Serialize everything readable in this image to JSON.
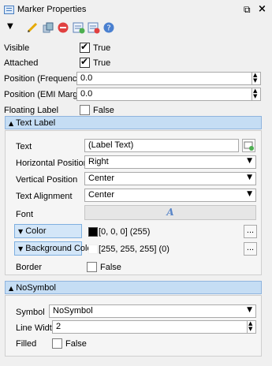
{
  "window": {
    "title": "Marker Properties",
    "float_icon": "float-icon",
    "close_icon": "close-icon"
  },
  "toolbar": {
    "icons": [
      "dropdown-arrow-icon",
      "pencil-icon",
      "copy-icon",
      "delete-icon",
      "export-icon",
      "import-icon",
      "help-icon"
    ]
  },
  "props": {
    "visible": {
      "label": "Visible",
      "value": "True"
    },
    "attached": {
      "label": "Attached",
      "value": "True"
    },
    "pos_freq": {
      "label": "Position (Frequency)",
      "value": "0.0"
    },
    "pos_emi": {
      "label": "Position (EMI Margin)",
      "value": "0.0"
    },
    "floating": {
      "label": "Floating Label",
      "value": "False"
    }
  },
  "text_label": {
    "header": "Text Label",
    "text": {
      "label": "Text",
      "value": "(Label Text)"
    },
    "hpos": {
      "label": "Horizontal Position",
      "value": "Right"
    },
    "vpos": {
      "label": "Vertical Position",
      "value": "Center"
    },
    "align": {
      "label": "Text Alignment",
      "value": "Center"
    },
    "font": {
      "label": "Font",
      "glyph": "A"
    },
    "color": {
      "label": "Color",
      "value": "[0, 0, 0] (255)",
      "swatch": "#000000"
    },
    "bgcolor": {
      "label": "Background Color",
      "value": "[255, 255, 255] (0)",
      "swatch": "#ffffff"
    },
    "border": {
      "label": "Border",
      "value": "False"
    },
    "more": "..."
  },
  "nosymbol": {
    "header": "NoSymbol",
    "symbol": {
      "label": "Symbol",
      "value": "NoSymbol"
    },
    "linewidth": {
      "label": "Line Width",
      "value": "2"
    },
    "filled": {
      "label": "Filled",
      "value": "False"
    }
  }
}
